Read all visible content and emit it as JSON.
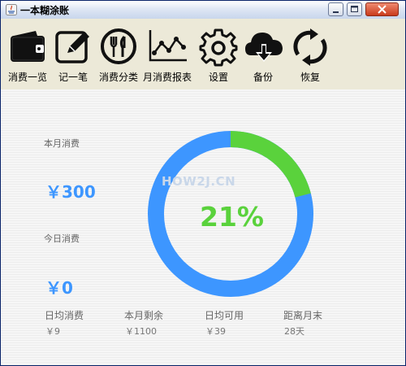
{
  "window": {
    "title": "一本糊涂账"
  },
  "toolbar": {
    "items": [
      {
        "label": "消费一览",
        "icon": "wallet-icon"
      },
      {
        "label": "记一笔",
        "icon": "edit-icon"
      },
      {
        "label": "消费分类",
        "icon": "utensils-icon"
      },
      {
        "label": "月消费报表",
        "icon": "line-chart-icon"
      },
      {
        "label": "设置",
        "icon": "gear-icon"
      },
      {
        "label": "备份",
        "icon": "cloud-download-icon"
      },
      {
        "label": "恢复",
        "icon": "restore-icon"
      }
    ]
  },
  "summary": {
    "month_label": "本月消费",
    "month_value": "￥300",
    "today_label": "今日消费",
    "today_value": "￥0",
    "percent_text": "21%",
    "percent_value": 0.21,
    "watermark": "HOW2J.CN",
    "colors": {
      "used": "#5ad23c",
      "remaining": "#3d96ff"
    }
  },
  "stats": [
    {
      "label": "日均消费",
      "value": "￥9"
    },
    {
      "label": "本月剩余",
      "value": "￥1100"
    },
    {
      "label": "日均可用",
      "value": "￥39"
    },
    {
      "label": "距离月末",
      "value": "28天"
    }
  ]
}
